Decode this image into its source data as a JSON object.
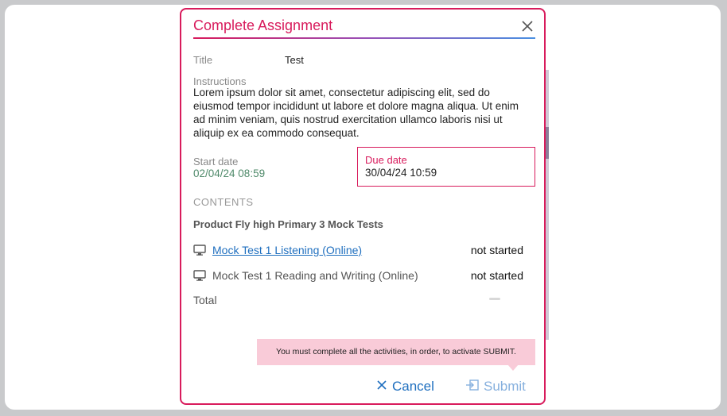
{
  "modal": {
    "title": "Complete Assignment",
    "close_icon": "close-icon",
    "title_label": "Title",
    "title_value": "Test",
    "instructions_label": "Instructions",
    "instructions_text": "Lorem ipsum dolor sit amet, consectetur adipiscing elit, sed do eiusmod tempor incididunt ut labore et dolore magna aliqua. Ut enim ad minim veniam, quis nostrud exercitation ullamco laboris nisi ut aliquip ex ea commodo consequat.",
    "start_label": "Start date",
    "start_value": "02/04/24 08:59",
    "due_label": "Due date",
    "due_value": "30/04/24 10:59",
    "contents_label": "CONTENTS",
    "product_label": "Product Fly high Primary 3 Mock Tests",
    "activities": [
      {
        "name": "Mock Test 1 Listening (Online)",
        "status": "not started",
        "icon": "monitor-icon"
      },
      {
        "name": "Mock Test 1 Reading and Writing (Online)",
        "status": "not started",
        "icon": "monitor-icon"
      }
    ],
    "total_label": "Total",
    "tooltip_text": "You must complete all the activities, in order, to activate SUBMIT.",
    "cancel_label": "Cancel",
    "submit_label": "Submit"
  },
  "colors": {
    "accent": "#d81b5c",
    "link": "#1f6fbf",
    "start_date": "#4f8a6a",
    "tooltip_bg": "#f9cbd8",
    "submit_disabled": "#86b0de"
  }
}
